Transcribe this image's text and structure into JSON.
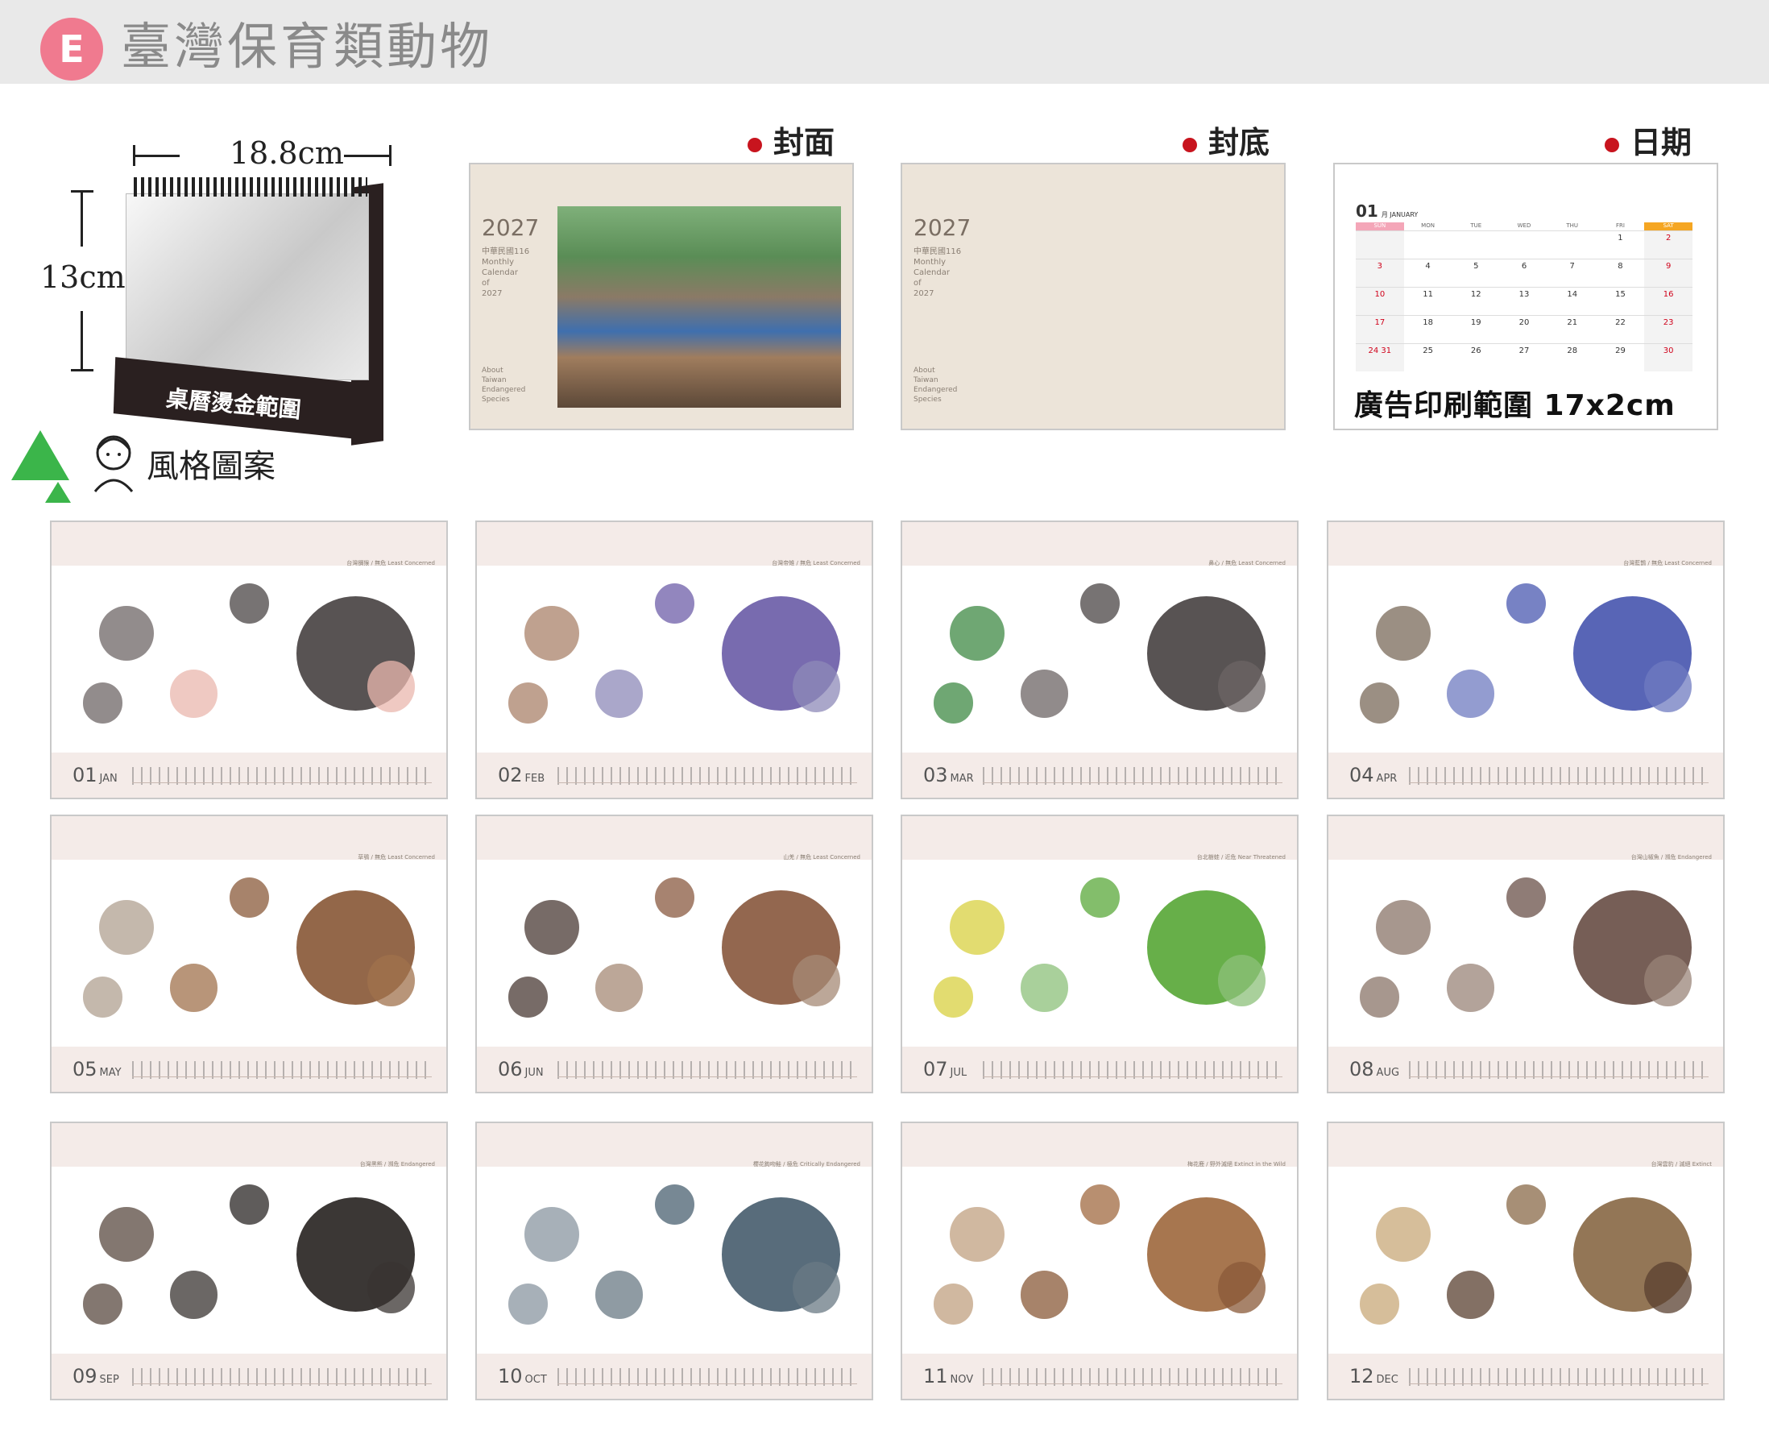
{
  "header": {
    "badge": "E",
    "title": "臺灣保育類動物"
  },
  "desk": {
    "width_label": "18.8cm",
    "height_label": "13cm",
    "base_label": "桌曆燙金範圍"
  },
  "style": {
    "label": "風格圖案"
  },
  "sections": {
    "cover": "封面",
    "back": "封底",
    "date": "日期"
  },
  "cover": {
    "year": "2027",
    "sub": "中華民國116\nMonthly\nCalendar\nof\n2027",
    "about": "About\nTaiwan\nEndangered\nSpecies"
  },
  "back": {
    "year": "2027",
    "sub": "中華民國116\nMonthly\nCalendar\nof\n2027",
    "about": "About\nTaiwan\nEndangered\nSpecies"
  },
  "date_panel": {
    "month_num": "01",
    "month_sub": "月 JANUARY",
    "days_header": [
      "SUN",
      "MON",
      "TUE",
      "WED",
      "THU",
      "FRI",
      "SAT"
    ],
    "rows": [
      [
        "",
        "",
        "",
        "",
        "",
        "1",
        "2"
      ],
      [
        "3",
        "4",
        "5",
        "6",
        "7",
        "8",
        "9"
      ],
      [
        "10",
        "11",
        "12",
        "13",
        "14",
        "15",
        "16"
      ],
      [
        "17",
        "18",
        "19",
        "20",
        "21",
        "22",
        "23"
      ],
      [
        "24|31",
        "25",
        "26",
        "27",
        "28",
        "29",
        "30"
      ]
    ],
    "ad_text": "廣告印刷範圍 17x2cm"
  },
  "months": [
    {
      "num": "01",
      "abbr": "JAN",
      "note": "台灣獼猴 / 無危 Least Concerned",
      "colors": [
        "#4a4444",
        "#6e6666",
        "#e9b7ad"
      ]
    },
    {
      "num": "02",
      "abbr": "FEB",
      "note": "台灣帝雉 / 無危 Least Concerned",
      "colors": [
        "#6d5ea8",
        "#a9826a",
        "#8e8ab8"
      ]
    },
    {
      "num": "03",
      "abbr": "MAR",
      "note": "鼻心 / 無危 Least Concerned",
      "colors": [
        "#4a4444",
        "#3f8a44",
        "#6c6464"
      ]
    },
    {
      "num": "04",
      "abbr": "APR",
      "note": "台灣藍鵲 / 無危 Least Concerned",
      "colors": [
        "#4a58b0",
        "#7a6a5a",
        "#6f7bc0"
      ]
    },
    {
      "num": "05",
      "abbr": "MAY",
      "note": "草鴞 / 無危 Least Concerned",
      "colors": [
        "#8a5a3a",
        "#b0a090",
        "#a0724c"
      ]
    },
    {
      "num": "06",
      "abbr": "JUN",
      "note": "山羌 / 無危 Least Concerned",
      "colors": [
        "#8a5a40",
        "#4a3a34",
        "#a58a76"
      ]
    },
    {
      "num": "07",
      "abbr": "JUL",
      "note": "台北樹蛙 / 近危 Near Threatened",
      "colors": [
        "#5aa83a",
        "#d8d040",
        "#8cc07a"
      ]
    },
    {
      "num": "08",
      "abbr": "AUG",
      "note": "台灣山椒魚 / 瀕危 Endangered",
      "colors": [
        "#6a5048",
        "#8a7468",
        "#9a8478"
      ]
    },
    {
      "num": "09",
      "abbr": "SEP",
      "note": "台灣黑熊 / 瀕危 Endangered",
      "colors": [
        "#2a2624",
        "#5a4a40",
        "#3a3432"
      ]
    },
    {
      "num": "10",
      "abbr": "OCT",
      "note": "櫻花鉤吻鮭 / 極危 Critically Endangered",
      "colors": [
        "#4a6070",
        "#8a96a0",
        "#6a7a84"
      ]
    },
    {
      "num": "11",
      "abbr": "NOV",
      "note": "梅花鹿 / 野外滅絕 Extinct in the Wild",
      "colors": [
        "#a06a40",
        "#c0a080",
        "#8a5a38"
      ]
    },
    {
      "num": "12",
      "abbr": "DEC",
      "note": "台灣雲豹 / 滅絕 Extinct",
      "colors": [
        "#8a6a48",
        "#c8a878",
        "#5a4030"
      ]
    }
  ]
}
